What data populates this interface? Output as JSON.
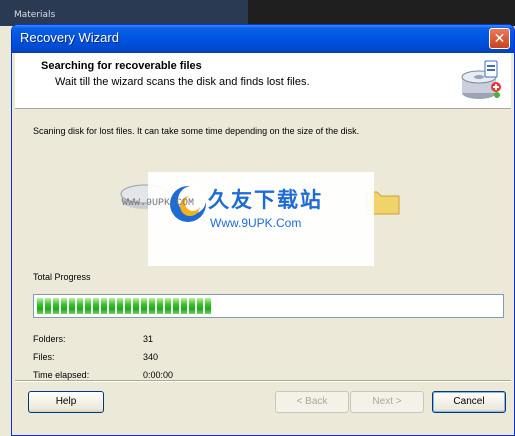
{
  "background": {
    "panel_label": "Materials"
  },
  "window": {
    "title": "Recovery Wizard",
    "close_glyph": "✕"
  },
  "header": {
    "title": "Searching for recoverable files",
    "subtitle": "Wait till the wizard scans the disk and finds lost files.",
    "icon": "disk-scan-icon"
  },
  "body": {
    "scan_message": "Scaning disk for lost files. It can take some time depending on the size of the disk."
  },
  "watermark": {
    "brand": "久友下载站",
    "url": "Www.9UPK.Com",
    "left_text": "WWW.9UPK.COM"
  },
  "progress": {
    "label": "Total Progress",
    "value_percent": 38,
    "color": "#2dbf24"
  },
  "stats": {
    "folders_label": "Folders:",
    "folders_value": "31",
    "files_label": "Files:",
    "files_value": "340",
    "elapsed_label": "Time elapsed:",
    "elapsed_value": "0:00:00"
  },
  "buttons": {
    "help": "Help",
    "back": "< Back",
    "next": "Next >",
    "cancel": "Cancel"
  },
  "colors": {
    "titlebar": "#0054e3",
    "dialog_bg": "#ece9d8",
    "accent": "#1e6bd6"
  }
}
